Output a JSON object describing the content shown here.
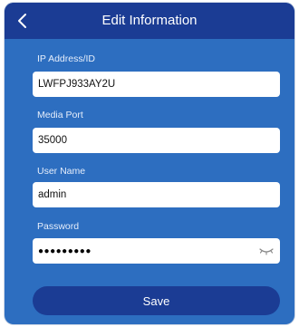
{
  "header": {
    "title": "Edit Information",
    "back_icon": "chevron-left-icon"
  },
  "form": {
    "ip": {
      "label": "IP Address/ID",
      "value": "LWFPJ933AY2U"
    },
    "port": {
      "label": "Media Port",
      "value": "35000"
    },
    "user": {
      "label": "User Name",
      "value": "admin"
    },
    "password": {
      "label": "Password",
      "value": "●●●●●●●●●",
      "toggle_icon": "eye-closed-icon"
    }
  },
  "save_label": "Save",
  "colors": {
    "header": "#1b3c94",
    "background": "#2d6ec0",
    "button": "#1b3c94"
  }
}
